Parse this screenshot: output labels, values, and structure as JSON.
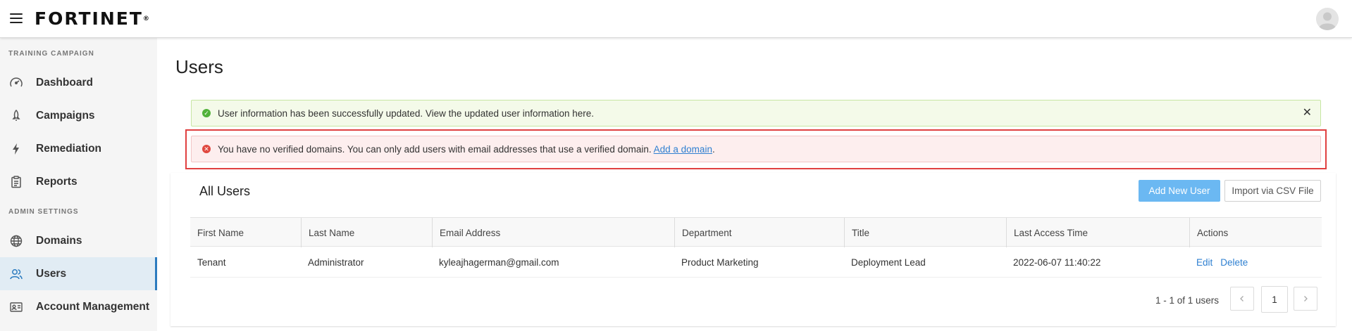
{
  "header": {
    "logo_text": "FORTINET",
    "logo_reg": "®",
    "menu_icon": "hamburger-menu-icon",
    "avatar_icon": "user-avatar-icon"
  },
  "sidebar": {
    "sections": [
      {
        "label": "TRAINING CAMPAIGN"
      },
      {
        "label": "ADMIN SETTINGS"
      }
    ],
    "items": [
      {
        "label": "Dashboard",
        "icon": "speedometer-icon"
      },
      {
        "label": "Campaigns",
        "icon": "rocket-icon"
      },
      {
        "label": "Remediation",
        "icon": "lightning-bolt-icon"
      },
      {
        "label": "Reports",
        "icon": "clipboard-icon"
      },
      {
        "label": "Domains",
        "icon": "globe-icon"
      },
      {
        "label": "Users",
        "icon": "users-icon",
        "active": true
      },
      {
        "label": "Account Management",
        "icon": "id-card-icon"
      }
    ]
  },
  "main": {
    "title": "Users",
    "alerts": {
      "success_text": "User information has been successfully updated. View the updated user information here.",
      "error_text": "You have no verified domains. You can only add users with email addresses that use a verified domain. ",
      "error_link": "Add a domain",
      "error_tail": "."
    },
    "card": {
      "title": "All Users",
      "add_button": "Add New User",
      "import_button": "Import via CSV File"
    },
    "table": {
      "columns": [
        "First Name",
        "Last Name",
        "Email Address",
        "Department",
        "Title",
        "Last Access Time",
        "Actions"
      ],
      "rows": [
        {
          "first_name": "Tenant",
          "last_name": "Administrator",
          "email": "kyleajhagerman@gmail.com",
          "department": "Product Marketing",
          "title": "Deployment Lead",
          "last_access": "2022-06-07 11:40:22",
          "edit": "Edit",
          "delete": "Delete"
        }
      ]
    },
    "pagination": {
      "summary": "1 - 1 of 1 users",
      "current_page": "1",
      "prev_icon": "chevron-left-icon",
      "next_icon": "chevron-right-icon"
    }
  },
  "colors": {
    "accent": "#2b7bbf",
    "primary_button": "#6bb8f2",
    "success": "#52b23b",
    "error": "#e0483f",
    "highlight": "#e04040"
  }
}
